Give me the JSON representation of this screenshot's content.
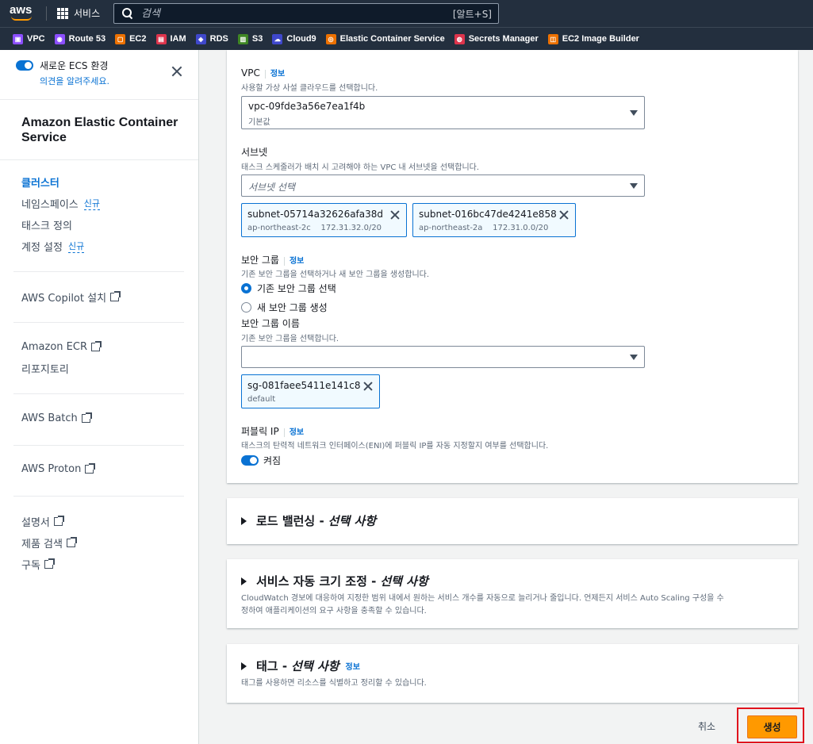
{
  "topnav": {
    "brand": "aws",
    "services_label": "서비스",
    "search_placeholder": "검색",
    "search_shortcut": "[알트+S]"
  },
  "favorites": [
    {
      "label": "VPC",
      "color": "#8c4fff"
    },
    {
      "label": "Route 53",
      "color": "#8c4fff"
    },
    {
      "label": "EC2",
      "color": "#ed7100"
    },
    {
      "label": "IAM",
      "color": "#dd344c"
    },
    {
      "label": "RDS",
      "color": "#3f48cc"
    },
    {
      "label": "S3",
      "color": "#3f8624"
    },
    {
      "label": "Cloud9",
      "color": "#3f48cc"
    },
    {
      "label": "Elastic Container Service",
      "color": "#ed7100"
    },
    {
      "label": "Secrets Manager",
      "color": "#dd344c"
    },
    {
      "label": "EC2 Image Builder",
      "color": "#ed7100"
    }
  ],
  "sidebar": {
    "new_ecs_label": "새로운 ECS 환경",
    "feedback_link": "의견을 알려주세요.",
    "title": "Amazon Elastic Container Service",
    "nav": [
      {
        "label": "클러스터",
        "badge": ""
      },
      {
        "label": "네임스페이스",
        "badge": "신규"
      },
      {
        "label": "태스크 정의",
        "badge": ""
      },
      {
        "label": "계정 설정",
        "badge": "신규"
      }
    ],
    "copilot": "AWS Copilot 설치",
    "ecr": "Amazon ECR",
    "repositories": "리포지토리",
    "batch": "AWS Batch",
    "proton": "AWS Proton",
    "docs": "설명서",
    "product_search": "제품 검색",
    "subscribe": "구독"
  },
  "network": {
    "vpc_label": "VPC",
    "info": "정보",
    "vpc_desc": "사용할 가상 사설 클라우드를 선택합니다.",
    "vpc_value": "vpc-09fde3a56e7ea1f4b",
    "vpc_sub": "기본값",
    "subnet_label": "서브넷",
    "subnet_desc": "태스크 스케줄러가 배치 시 고려해야 하는 VPC 내 서브넷을 선택합니다.",
    "subnet_placeholder": "서브넷 선택",
    "subnets": [
      {
        "id": "subnet-05714a32626afa38d",
        "az": "ap-northeast-2c",
        "cidr": "172.31.32.0/20"
      },
      {
        "id": "subnet-016bc47de4241e858",
        "az": "ap-northeast-2a",
        "cidr": "172.31.0.0/20"
      }
    ],
    "sg_label": "보안 그룹",
    "sg_desc": "기존 보안 그룹을 선택하거나 새 보안 그룹을 생성합니다.",
    "sg_existing": "기존 보안 그룹 선택",
    "sg_new": "새 보안 그룹 생성",
    "sg_name_label": "보안 그룹 이름",
    "sg_name_desc": "기존 보안 그룹을 선택합니다.",
    "sg_token": {
      "id": "sg-081faee5411e141c8",
      "name": "default"
    },
    "public_ip_label": "퍼블릭 IP",
    "public_ip_desc": "태스크의 탄력적 네트워크 인터페이스(ENI)에 퍼블릭 IP를 자동 지정할지 여부를 선택합니다.",
    "public_ip_state": "켜짐"
  },
  "sections": {
    "lb_title": "로드 밸런싱 -",
    "lb_optional": "선택 사항",
    "as_title": "서비스 자동 크기 조정 -",
    "as_optional": "선택 사항",
    "as_desc1": "CloudWatch 경보에 대응하여 지정한 범위 내에서 원하는 서비스 개수를 자동으로 늘리거나 줄입니다. 언제든지 서비스 Auto Scaling 구성을 수",
    "as_desc2": "정하여 애플리케이션의 요구 사항을 충족할 수 있습니다.",
    "tag_title": "태그 -",
    "tag_optional": "선택 사항",
    "tag_info": "정보",
    "tag_desc": "태그를 사용하면 리소스를 식별하고 정리할 수 있습니다."
  },
  "actions": {
    "cancel": "취소",
    "create": "생성"
  }
}
